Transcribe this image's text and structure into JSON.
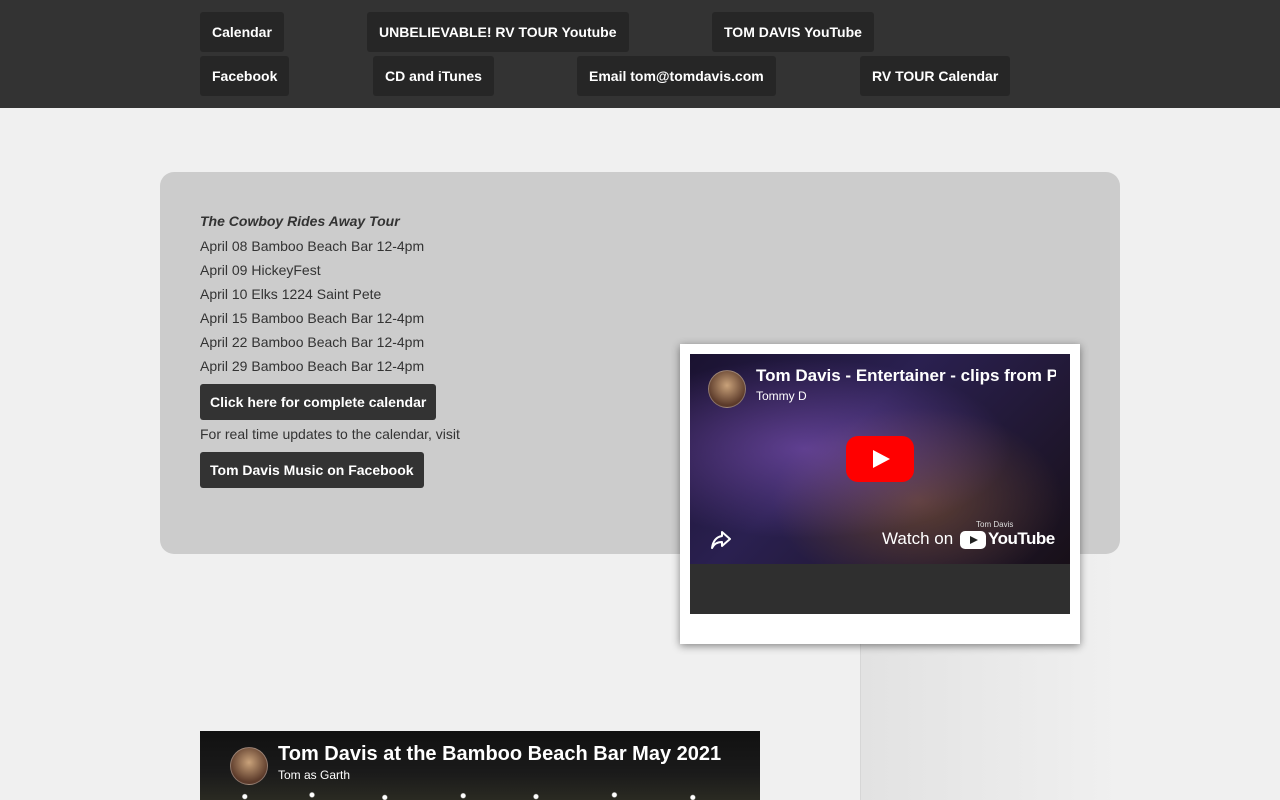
{
  "nav": {
    "row1": [
      "Calendar",
      "UNBELIEVABLE! RV TOUR Youtube",
      "TOM DAVIS YouTube"
    ],
    "row2": [
      "Facebook",
      "CD and iTunes",
      "Email tom@tomdavis.com",
      "RV TOUR Calendar"
    ]
  },
  "tour": {
    "title": "The Cowboy Rides Away Tour",
    "dates": [
      "April 08 Bamboo Beach Bar 12-4pm",
      "April 09 HickeyFest",
      "April 10 Elks 1224 Saint Pete",
      "April 15 Bamboo Beach Bar 12-4pm",
      "April 22 Bamboo Beach Bar 12-4pm",
      "April 29 Bamboo Beach Bar 12-4pm"
    ],
    "calendar_button": "Click here for complete calendar",
    "updates_text": "For real time updates to the calendar, visit",
    "facebook_button": "Tom Davis Music on Facebook"
  },
  "video1": {
    "title": "Tom Davis - Entertainer - clips from P",
    "channel": "Tommy D",
    "watch_on": "Watch on",
    "youtube": "YouTube",
    "tiny_label": "Tom Davis"
  },
  "video2": {
    "title": "Tom Davis at the Bamboo Beach Bar May 2021",
    "channel": "Tom as Garth"
  },
  "colors": {
    "topbar": "#333333",
    "button_bg": "#262626",
    "panel_bg": "#cccccc",
    "page_bg": "#f0f0f0",
    "play_red": "#ff0000"
  }
}
